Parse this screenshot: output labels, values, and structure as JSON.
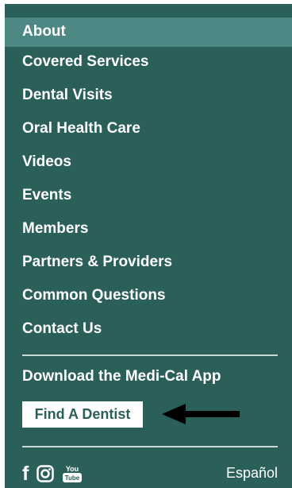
{
  "menu": {
    "items": [
      {
        "label": "About",
        "active": true
      },
      {
        "label": "Covered Services"
      },
      {
        "label": "Dental Visits"
      },
      {
        "label": "Oral Health Care"
      },
      {
        "label": "Videos"
      },
      {
        "label": "Events"
      },
      {
        "label": "Members"
      },
      {
        "label": "Partners & Providers"
      },
      {
        "label": "Common Questions"
      },
      {
        "label": "Contact Us"
      }
    ]
  },
  "app_link": "Download the Medi-Cal App",
  "find_dentist": "Find A Dentist",
  "language_link": "Español",
  "social": {
    "icons": [
      "facebook-icon",
      "instagram-icon",
      "youtube-icon"
    ],
    "youtube_text_top": "You",
    "youtube_text_bottom": "Tube"
  },
  "colors": {
    "panel": "#2b5f5a",
    "active_item": "#4e8884",
    "divider": "#c7dad8",
    "text": "#ffffff"
  }
}
